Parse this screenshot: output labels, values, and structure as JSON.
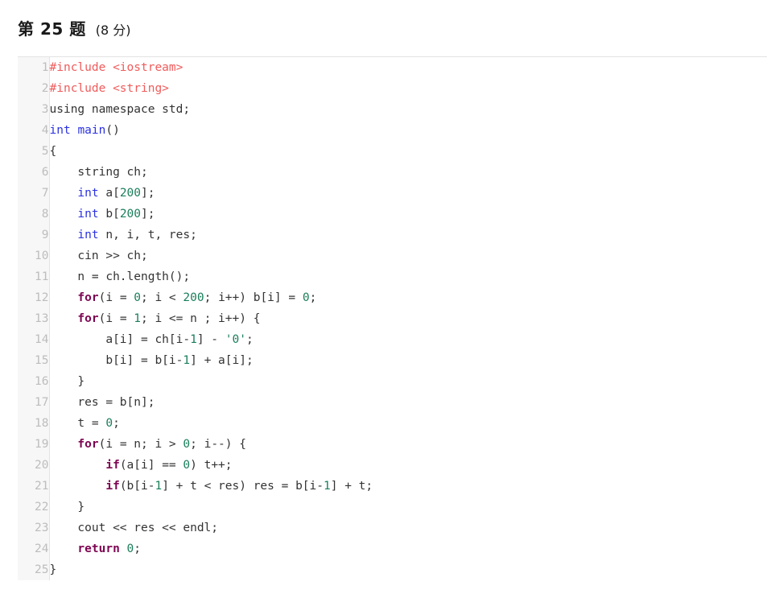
{
  "header": {
    "question_label": "第 25 题",
    "score_label": "(8 分)"
  },
  "code_block": {
    "language": "cpp",
    "line_count": 25,
    "line_numbers": [
      "1",
      "2",
      "3",
      "4",
      "5",
      "6",
      "7",
      "8",
      "9",
      "10",
      "11",
      "12",
      "13",
      "14",
      "15",
      "16",
      "17",
      "18",
      "19",
      "20",
      "21",
      "22",
      "23",
      "24",
      "25"
    ],
    "lines": [
      "#include <iostream>",
      "#include <string>",
      "using namespace std;",
      "int main()",
      "{",
      "    string ch;",
      "    int a[200];",
      "    int b[200];",
      "    int n, i, t, res;",
      "    cin >> ch;",
      "    n = ch.length();",
      "    for(i = 0; i < 200; i++) b[i] = 0;",
      "    for(i = 1; i <= n ; i++) {",
      "        a[i] = ch[i-1] - '0';",
      "        b[i] = b[i-1] + a[i];",
      "    }",
      "    res = b[n];",
      "    t = 0;",
      "    for(i = n; i > 0; i--) {",
      "        if(a[i] == 0) t++;",
      "        if(b[i-1] + t < res) res = b[i-1] + t;",
      "    }",
      "    cout << res << endl;",
      "    return 0;",
      "}"
    ],
    "tokens": [
      [
        [
          "#include <iostream>",
          "pre"
        ]
      ],
      [
        [
          "#include <string>",
          "pre"
        ]
      ],
      [
        [
          "using namespace std;",
          "plain"
        ]
      ],
      [
        [
          "int",
          "type"
        ],
        [
          " ",
          "plain"
        ],
        [
          "main",
          "fn"
        ],
        [
          "()",
          "plain"
        ]
      ],
      [
        [
          "{",
          "plain"
        ]
      ],
      [
        [
          "    string ch;",
          "plain"
        ]
      ],
      [
        [
          "    ",
          "plain"
        ],
        [
          "int",
          "type"
        ],
        [
          " a[",
          "plain"
        ],
        [
          "200",
          "num"
        ],
        [
          "];",
          "plain"
        ]
      ],
      [
        [
          "    ",
          "plain"
        ],
        [
          "int",
          "type"
        ],
        [
          " b[",
          "plain"
        ],
        [
          "200",
          "num"
        ],
        [
          "];",
          "plain"
        ]
      ],
      [
        [
          "    ",
          "plain"
        ],
        [
          "int",
          "type"
        ],
        [
          " n, i, t, res;",
          "plain"
        ]
      ],
      [
        [
          "    cin >> ch;",
          "plain"
        ]
      ],
      [
        [
          "    n = ch.length();",
          "plain"
        ]
      ],
      [
        [
          "    ",
          "plain"
        ],
        [
          "for",
          "kw"
        ],
        [
          "(i = ",
          "plain"
        ],
        [
          "0",
          "num"
        ],
        [
          "; i < ",
          "plain"
        ],
        [
          "200",
          "num"
        ],
        [
          "; i++) b[i] = ",
          "plain"
        ],
        [
          "0",
          "num"
        ],
        [
          ";",
          "plain"
        ]
      ],
      [
        [
          "    ",
          "plain"
        ],
        [
          "for",
          "kw"
        ],
        [
          "(i = ",
          "plain"
        ],
        [
          "1",
          "num"
        ],
        [
          "; i <= n ; i++) {",
          "plain"
        ]
      ],
      [
        [
          "        a[i] = ch[i-",
          "plain"
        ],
        [
          "1",
          "num"
        ],
        [
          "] - ",
          "plain"
        ],
        [
          "'0'",
          "str"
        ],
        [
          ";",
          "plain"
        ]
      ],
      [
        [
          "        b[i] = b[i-",
          "plain"
        ],
        [
          "1",
          "num"
        ],
        [
          "] + a[i];",
          "plain"
        ]
      ],
      [
        [
          "    }",
          "plain"
        ]
      ],
      [
        [
          "    res = b[n];",
          "plain"
        ]
      ],
      [
        [
          "    t = ",
          "plain"
        ],
        [
          "0",
          "num"
        ],
        [
          ";",
          "plain"
        ]
      ],
      [
        [
          "    ",
          "plain"
        ],
        [
          "for",
          "kw"
        ],
        [
          "(i = n; i > ",
          "plain"
        ],
        [
          "0",
          "num"
        ],
        [
          "; i--) {",
          "plain"
        ]
      ],
      [
        [
          "        ",
          "plain"
        ],
        [
          "if",
          "kw"
        ],
        [
          "(a[i] == ",
          "plain"
        ],
        [
          "0",
          "num"
        ],
        [
          ") t++;",
          "plain"
        ]
      ],
      [
        [
          "        ",
          "plain"
        ],
        [
          "if",
          "kw"
        ],
        [
          "(b[i-",
          "plain"
        ],
        [
          "1",
          "num"
        ],
        [
          "] + t < res) res = b[i-",
          "plain"
        ],
        [
          "1",
          "num"
        ],
        [
          "] + t;",
          "plain"
        ]
      ],
      [
        [
          "    }",
          "plain"
        ]
      ],
      [
        [
          "    cout << res << endl;",
          "plain"
        ]
      ],
      [
        [
          "    ",
          "plain"
        ],
        [
          "return",
          "kw"
        ],
        [
          " ",
          "plain"
        ],
        [
          "0",
          "num"
        ],
        [
          ";",
          "plain"
        ]
      ],
      [
        [
          "}",
          "plain"
        ]
      ]
    ]
  },
  "colors": {
    "page_background": "#ffffff",
    "gutter_background": "#f7f7f7",
    "gutter_border": "#e3e3e3",
    "line_number": "#bdbdbd",
    "code_text": "#333333",
    "preprocessor": "#f05b5b",
    "type_keyword": "#2b32e0",
    "control_keyword": "#7d0552",
    "number_literal": "#1a7f5a",
    "string_literal": "#1a7f5a"
  }
}
